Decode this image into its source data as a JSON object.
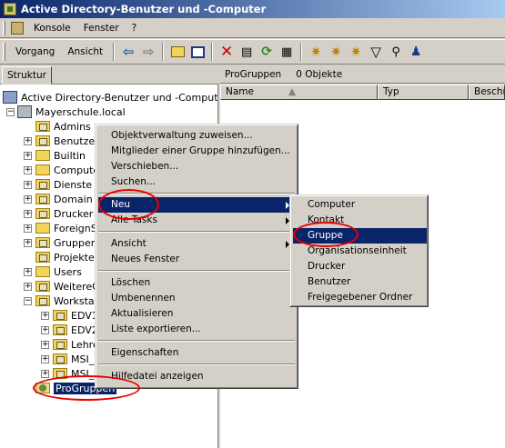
{
  "window": {
    "title": "Active Directory-Benutzer und -Computer"
  },
  "menubar": {
    "items": [
      "Konsole",
      "Fenster",
      "?"
    ]
  },
  "toolbar": {
    "vorgang": "Vorgang",
    "ansicht": "Ansicht"
  },
  "left_pane": {
    "tab": "Struktur"
  },
  "tree": {
    "root": "Active Directory-Benutzer und -Computer [m",
    "domain": "Mayerschule.local",
    "ous": [
      "Admins",
      "Benutzer",
      "Builtin",
      "Computer",
      "Dienste",
      "Domain C",
      "Drucker",
      "ForeignS",
      "Gruppen",
      "Projekte",
      "Users",
      "WeitereC",
      "Workstat"
    ],
    "workstat_children": [
      "EDV1",
      "EDV2",
      "Lehre",
      "MSI_",
      "MSI_"
    ],
    "selected": "ProGruppen"
  },
  "right_pane": {
    "title": "ProGruppen",
    "count": "0 Objekte",
    "columns": [
      "Name",
      "Typ",
      "Beschr"
    ]
  },
  "context_menu": {
    "items": [
      "Objektverwaltung zuweisen...",
      "Mitglieder einer Gruppe hinzufügen...",
      "Verschieben...",
      "Suchen...",
      "Neu",
      "Alle Tasks",
      "Ansicht",
      "Neues Fenster",
      "Löschen",
      "Umbenennen",
      "Aktualisieren",
      "Liste exportieren...",
      "Eigenschaften",
      "Hilfedatei anzeigen"
    ]
  },
  "submenu": {
    "items": [
      "Computer",
      "Kontakt",
      "Gruppe",
      "Organisationseinheit",
      "Drucker",
      "Benutzer",
      "Freigegebener Ordner"
    ]
  },
  "colors": {
    "highlight": "#0a246a",
    "annotation": "#e80000"
  }
}
